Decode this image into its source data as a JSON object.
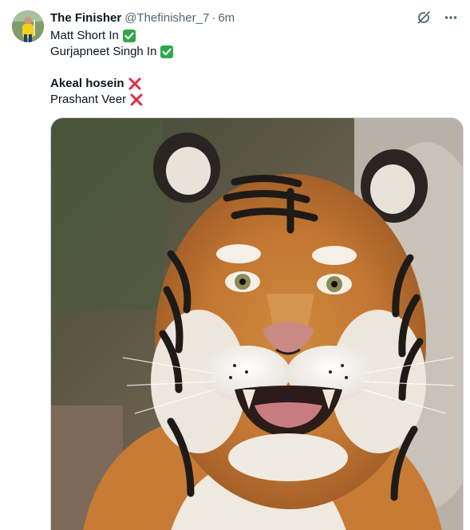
{
  "tweet": {
    "author": {
      "display_name": "The Finisher",
      "handle": "@Thefinisher_7",
      "separator": "·",
      "time": "6m"
    },
    "lines": [
      {
        "text": "Matt Short In",
        "emoji": "check-mark-icon"
      },
      {
        "text": "Gurjapneet Singh In",
        "emoji": "check-mark-icon"
      },
      {
        "text": "Akeal hosein",
        "emoji": "cross-mark-icon",
        "bold": true
      },
      {
        "text": "Prashant Veer",
        "emoji": "cross-mark-icon"
      }
    ],
    "media": {
      "subject": "tiger-photo"
    }
  },
  "icons": {
    "grok": "grok-icon",
    "more": "more-icon"
  },
  "colors": {
    "text": "#0f1419",
    "secondary": "#536471",
    "check_green": "#2ea84a",
    "cross_red": "#dd2e44",
    "border": "#cfd9de"
  }
}
